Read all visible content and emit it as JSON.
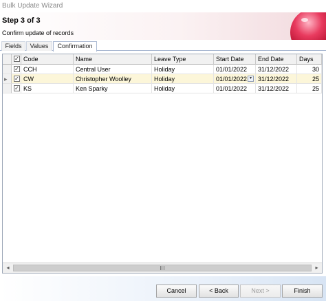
{
  "window": {
    "title": "Bulk Update Wizard"
  },
  "header": {
    "step": "Step 3 of 3",
    "subtitle": "Confirm update of records"
  },
  "tabs": [
    {
      "label": "Fields"
    },
    {
      "label": "Values"
    },
    {
      "label": "Confirmation",
      "active": true
    }
  ],
  "grid": {
    "select_all_checked": "✓",
    "columns": [
      "Code",
      "Name",
      "Leave Type",
      "Start Date",
      "End Date",
      "Days"
    ],
    "rows": [
      {
        "checked": "✓",
        "code": "CCH",
        "name": "Central User",
        "leave_type": "Holiday",
        "start_date": "01/01/2022",
        "end_date": "31/12/2022",
        "days": "30"
      },
      {
        "checked": "✓",
        "code": "CW",
        "name": "Christopher Woolley",
        "leave_type": "Holiday",
        "start_date": "01/01/2022",
        "end_date": "31/12/2022",
        "days": "25",
        "selected": true,
        "indicator": "▸",
        "dropdown_glyph": "▾"
      },
      {
        "checked": "✓",
        "code": "KS",
        "name": "Ken Sparky",
        "leave_type": "Holiday",
        "start_date": "01/01/2022",
        "end_date": "31/12/2022",
        "days": "25"
      }
    ],
    "scroll_left": "◂",
    "scroll_right": "▸"
  },
  "buttons": {
    "cancel": "Cancel",
    "back": "< Back",
    "next": "Next >",
    "finish": "Finish"
  },
  "colors": {
    "selected_row": "#fcf6d9",
    "orb": "#c8143a",
    "tab_border": "#a9b8d1"
  }
}
